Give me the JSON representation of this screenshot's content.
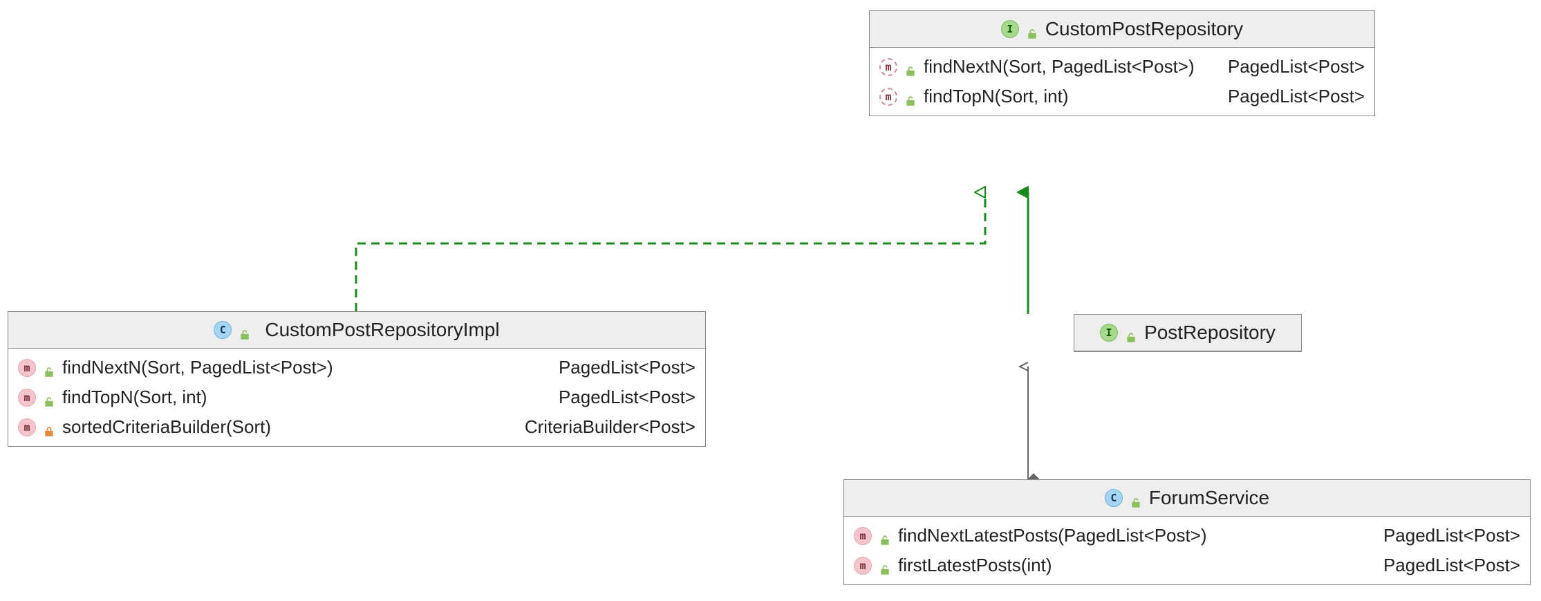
{
  "classes": {
    "customPostRepository": {
      "name": "CustomPostRepository",
      "kind": "interface",
      "methods": [
        {
          "signature": "findNextN(Sort, PagedList<Post>)",
          "returns": "PagedList<Post>",
          "visibility": "public",
          "abstract": true
        },
        {
          "signature": "findTopN(Sort, int)",
          "returns": "PagedList<Post>",
          "visibility": "public",
          "abstract": true
        }
      ]
    },
    "customPostRepositoryImpl": {
      "name": "CustomPostRepositoryImpl",
      "kind": "class",
      "methods": [
        {
          "signature": "findNextN(Sort, PagedList<Post>)",
          "returns": "PagedList<Post>",
          "visibility": "public",
          "abstract": false
        },
        {
          "signature": "findTopN(Sort, int)",
          "returns": "PagedList<Post>",
          "visibility": "public",
          "abstract": false
        },
        {
          "signature": "sortedCriteriaBuilder(Sort)",
          "returns": "CriteriaBuilder<Post>",
          "visibility": "private",
          "abstract": false
        }
      ]
    },
    "postRepository": {
      "name": "PostRepository",
      "kind": "interface"
    },
    "forumService": {
      "name": "ForumService",
      "kind": "class",
      "methods": [
        {
          "signature": "findNextLatestPosts(PagedList<Post>)",
          "returns": "PagedList<Post>",
          "visibility": "public",
          "abstract": false
        },
        {
          "signature": "firstLatestPosts(int)",
          "returns": "PagedList<Post>",
          "visibility": "public",
          "abstract": false
        }
      ]
    }
  },
  "badge_letters": {
    "interface": "I",
    "class": "C",
    "method": "m"
  },
  "relationships": [
    {
      "from": "CustomPostRepositoryImpl",
      "to": "CustomPostRepository",
      "type": "realization"
    },
    {
      "from": "PostRepository",
      "to": "CustomPostRepository",
      "type": "generalization"
    },
    {
      "from": "ForumService",
      "to": "PostRepository",
      "type": "aggregation-dependency"
    }
  ],
  "colors": {
    "green_arrow": "#1a8a1a",
    "gray_arrow": "#666666",
    "box_border": "#888888",
    "header_bg": "#eeeeee"
  }
}
